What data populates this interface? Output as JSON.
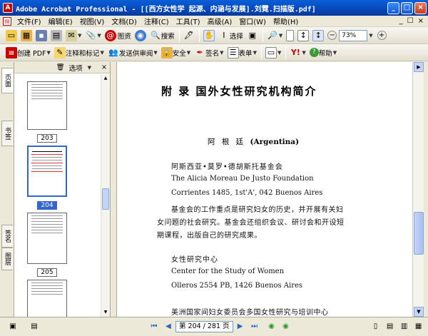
{
  "window": {
    "title": "Adobe Acrobat Professional - [[西方女性学 起源、内涵与发展].刘霓.扫描版.pdf]",
    "app_icon": "A"
  },
  "menu": {
    "items": [
      "文件(F)",
      "编辑(E)",
      "视图(V)",
      "文档(D)",
      "注释(C)",
      "工具(T)",
      "高级(A)",
      "窗口(W)",
      "帮助(H)"
    ],
    "right_controls": [
      "_",
      "☐",
      "×"
    ]
  },
  "toolbar1": {
    "search_label": "搜索",
    "select_label": "选择",
    "zoom_value": "73%"
  },
  "toolbar2": {
    "create_pdf": "创建 PDF",
    "comment_markup": "注释和标记",
    "send_review": "发送供审阅",
    "secure": "安全",
    "sign": "签名",
    "forms": "表单",
    "help": "帮助"
  },
  "thumbpanel": {
    "options_label": "选项",
    "close": "×",
    "labels": [
      "203",
      "204",
      "205"
    ]
  },
  "navtabs": [
    "页面",
    "书签",
    "签名",
    "图层"
  ],
  "document": {
    "title": "附 录   国外女性研究机构简介",
    "author_cn": "阿 根 廷",
    "author_en": "(Argentina)",
    "lines": [
      "阿斯西亚•莫罗•德胡斯托基金会",
      "The Alicia Moreau De Justo Foundation",
      "Corrientes 1485, 1st'A', 042 Buenos Aires",
      "基金会的工作重点是研究妇女的历史，并开展有关妇",
      "女问题的社会研究。基金会还组织会议、研讨会和开设短",
      "期课程，出版自己的研究成果。",
      "女性研究中心",
      "Center for the Study of Women",
      "Olleros 2554 PB, 1426 Buenos Aires",
      "美洲国家间妇女委员会多国女性研究与培训中心"
    ]
  },
  "statusbar": {
    "page_indicator": "第 204 / 281 页"
  }
}
